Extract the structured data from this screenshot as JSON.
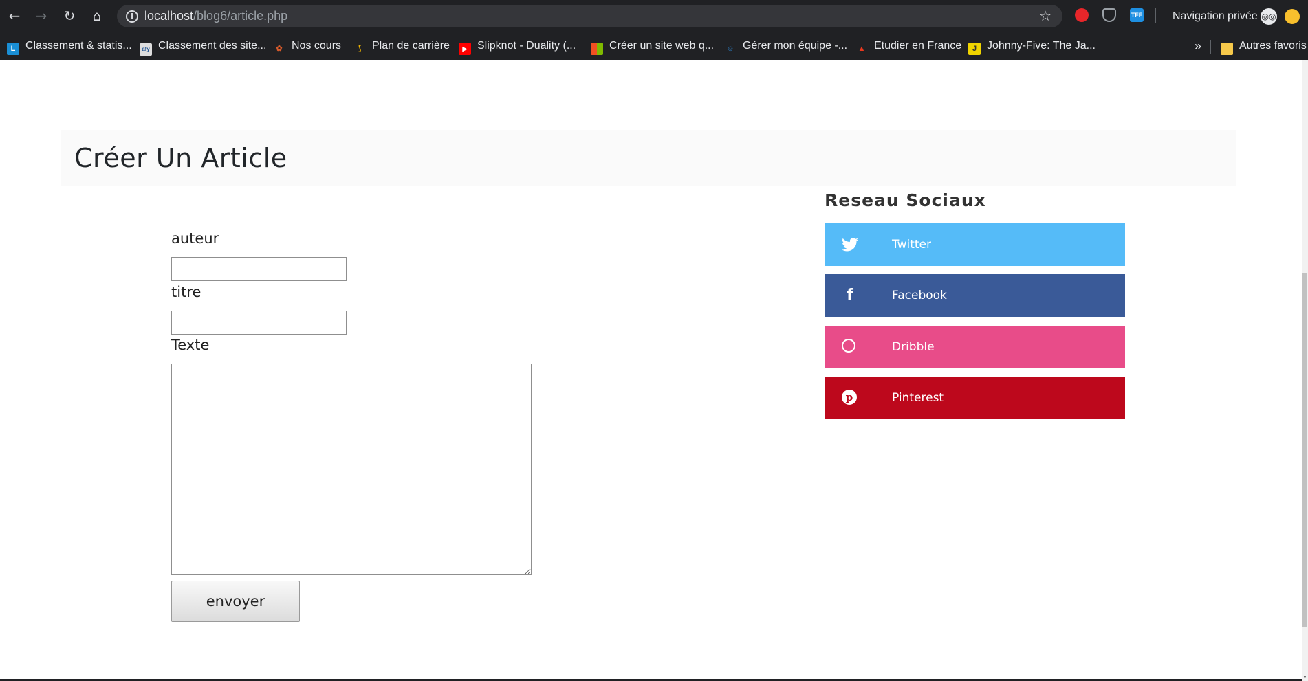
{
  "browser": {
    "url_host": "localhost",
    "url_path": "/blog6/article.php",
    "incognito_label": "Navigation privée",
    "icons": {
      "back": "back-arrow-icon",
      "forward": "forward-arrow-icon",
      "reload": "reload-icon",
      "home": "home-icon",
      "info": "info-icon",
      "star": "star-icon"
    }
  },
  "bookmarks": {
    "items": [
      {
        "label": "Classement & statis...",
        "color": "#1a8fd6",
        "glyph": "L"
      },
      {
        "label": "Classement des site...",
        "color": "#dddddd",
        "glyph": "afy"
      },
      {
        "label": "Nos cours",
        "color": "#d85a2a",
        "glyph": "✿"
      },
      {
        "label": "Plan de carrière",
        "color": "#f0b400",
        "glyph": "⟆"
      },
      {
        "label": "Slipknot - Duality (...",
        "color": "#ff0000",
        "glyph": "▶"
      },
      {
        "label": "Créer un site web q...",
        "color": "#7fba00",
        "glyph": "■"
      },
      {
        "label": "Gérer mon équipe -...",
        "color": "#2b7bbf",
        "glyph": "☺"
      },
      {
        "label": "Etudier en France",
        "color": "#e8381e",
        "glyph": "▲"
      },
      {
        "label": "Johnny-Five: The Ja...",
        "color": "#f0d400",
        "glyph": "J"
      }
    ],
    "more": "»",
    "other_favorites": "Autres favoris"
  },
  "page": {
    "title": "Créer Un Article",
    "form": {
      "author_label": "auteur",
      "author_value": "",
      "title_label": "titre",
      "title_value": "",
      "text_label": "Texte",
      "text_value": "",
      "submit_label": "envoyer"
    },
    "sidebar": {
      "heading": "Reseau Sociaux",
      "links": [
        {
          "label": "Twitter",
          "icon": "twitter-icon",
          "color": "#55bbf8"
        },
        {
          "label": "Facebook",
          "icon": "facebook-icon",
          "color": "#3a5a98"
        },
        {
          "label": "Dribble",
          "icon": "dribbble-icon",
          "color": "#e84c89"
        },
        {
          "label": "Pinterest",
          "icon": "pinterest-icon",
          "color": "#bd081c"
        }
      ]
    }
  }
}
